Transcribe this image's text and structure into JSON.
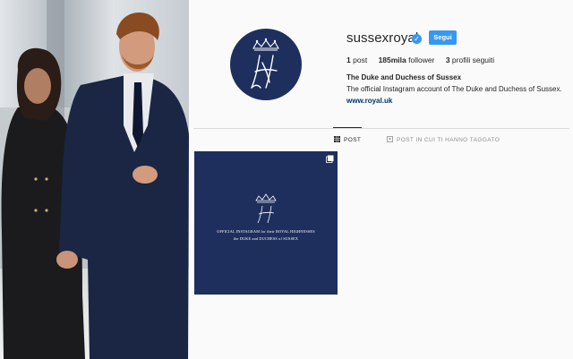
{
  "profile": {
    "username": "sussexroyal",
    "follow_label": "Segui",
    "stats": {
      "posts_count": "1",
      "posts_label": "post",
      "followers_count": "185mila",
      "followers_label": "follower",
      "following_count": "3",
      "following_label": "profili seguiti"
    },
    "full_name": "The Duke and Duchess of Sussex",
    "bio": "The official Instagram account of The Duke and Duchess of Sussex.",
    "website": "www.royal.uk"
  },
  "tabs": [
    {
      "label": "POST",
      "icon": "grid-icon",
      "active": true
    },
    {
      "label": "POST IN CUI TI HANNO TAGGATO",
      "icon": "tag-icon",
      "active": false
    }
  ],
  "posts": [
    {
      "line1": "OFFICIAL INSTAGRAM for their ROYAL HIGHNESSES",
      "line2": "the DUKE and DUCHESS of SUSSEX",
      "multi": true
    }
  ],
  "colors": {
    "accent": "#3897f0",
    "royal_navy": "#1e2f5e",
    "text": "#262626",
    "muted": "#8e8e8e",
    "link": "#003569"
  }
}
